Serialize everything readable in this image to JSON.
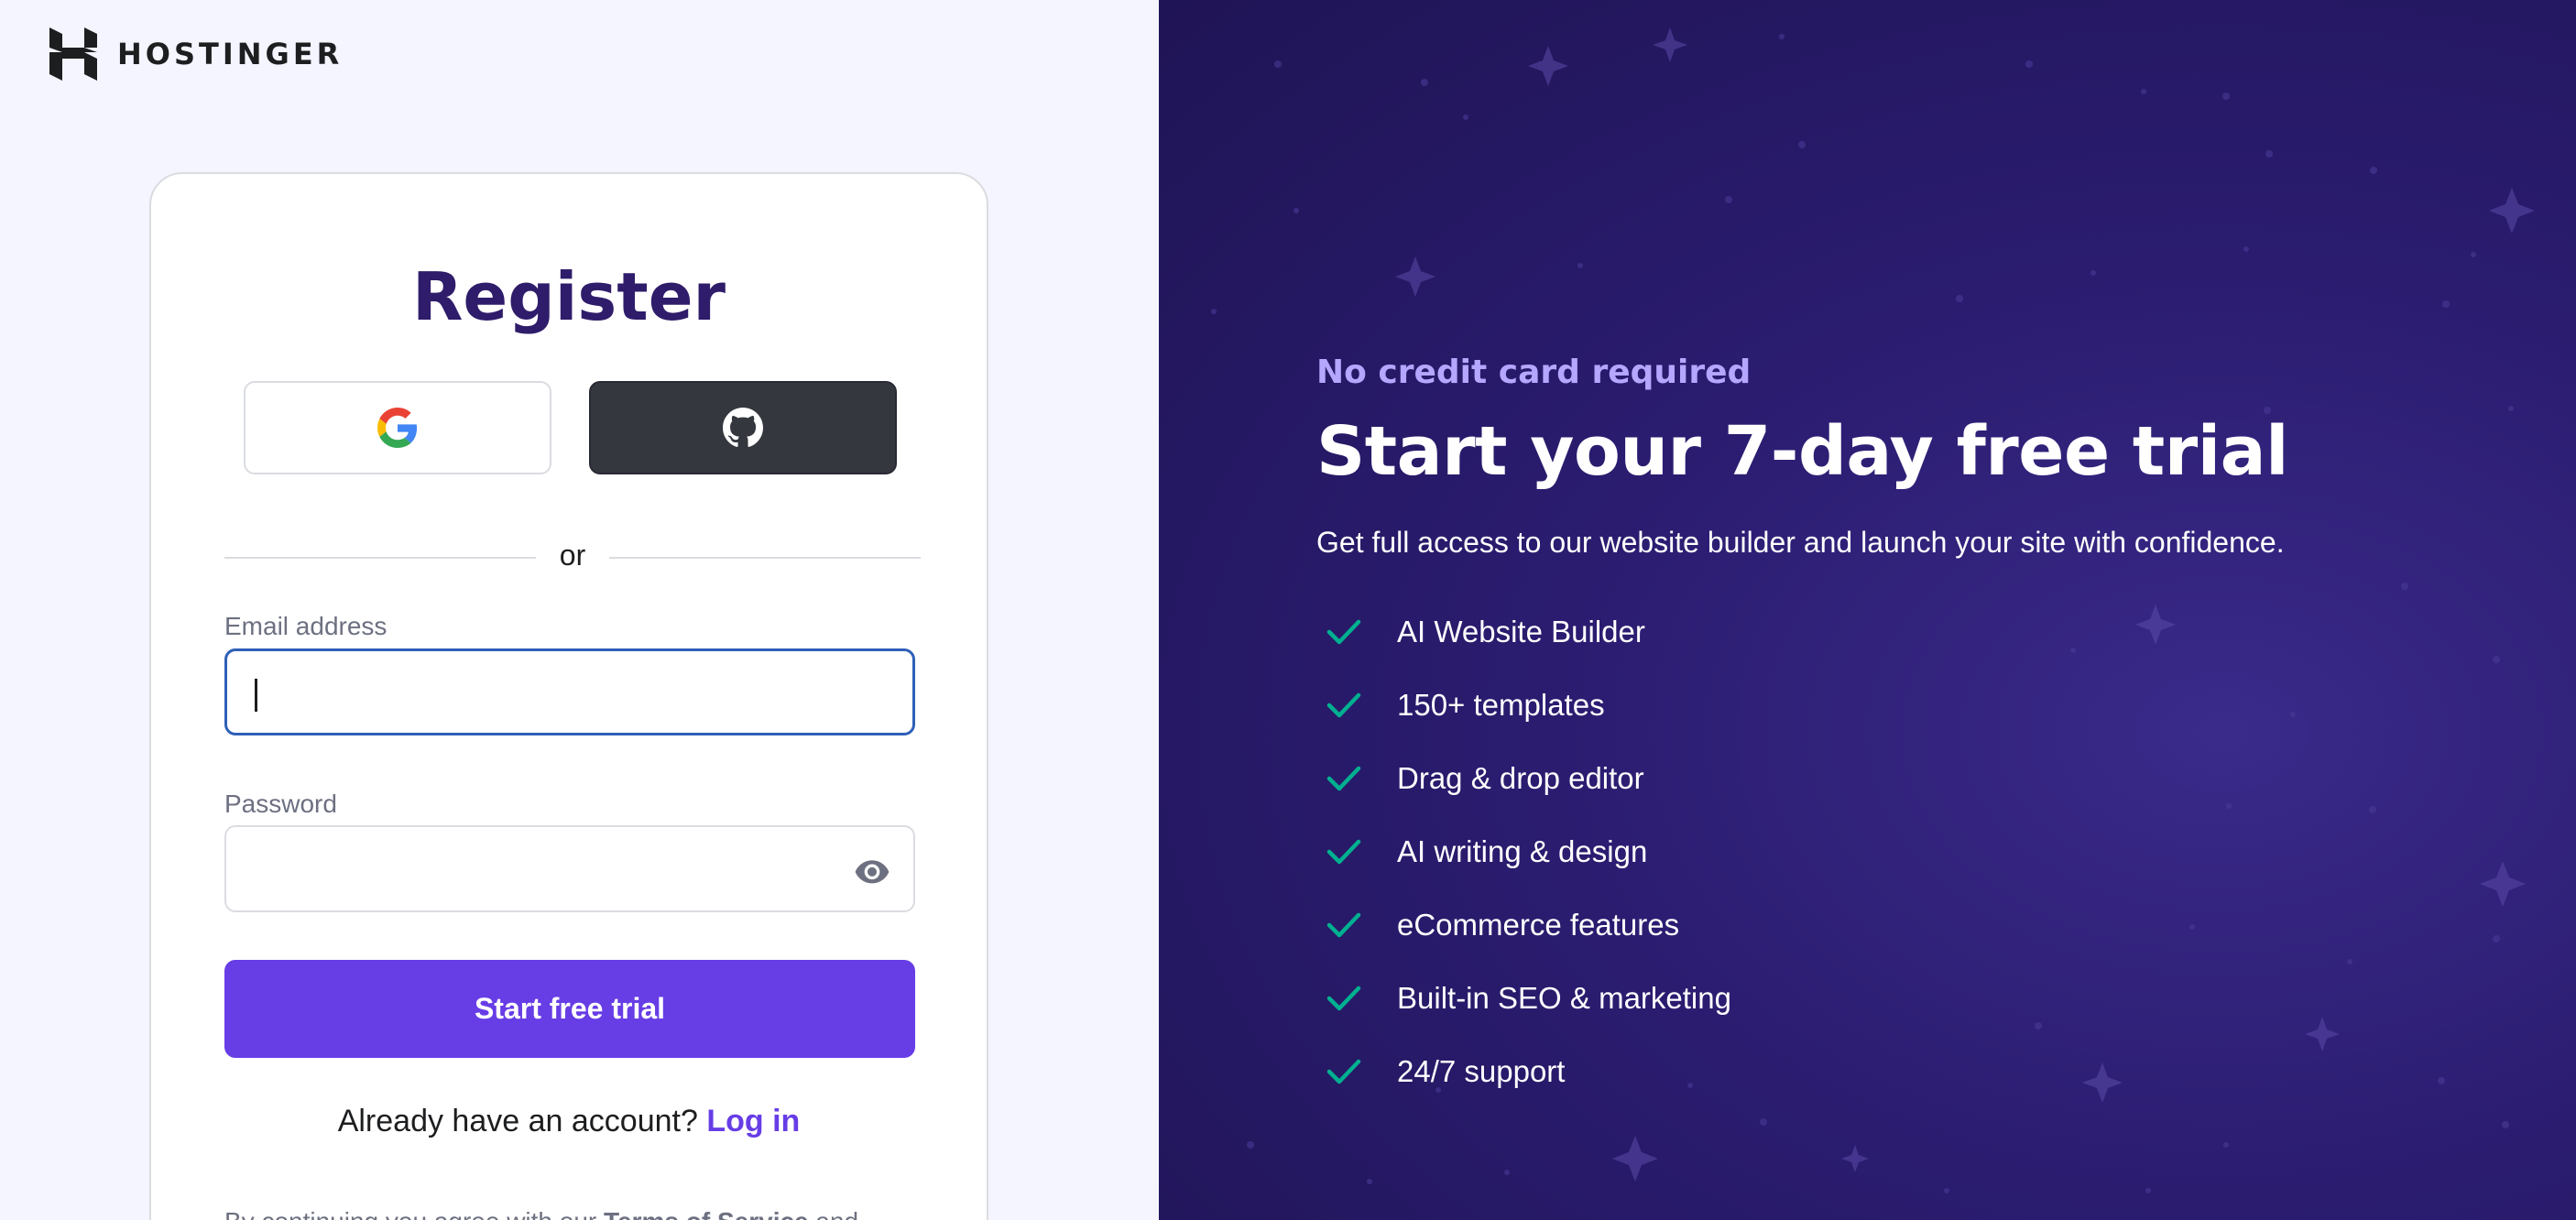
{
  "brand": {
    "name": "HOSTINGER"
  },
  "register": {
    "title": "Register",
    "google_icon": "google-icon",
    "github_icon": "github-icon",
    "divider_text": "or",
    "email_label": "Email address",
    "email_value": "",
    "password_label": "Password",
    "password_value": "",
    "password_toggle_icon": "eye-icon",
    "submit_label": "Start free trial",
    "login_prompt": "Already have an account?",
    "login_link": "Log in",
    "terms_prefix": "By continuing you agree with our",
    "terms_link": "Terms of Service",
    "terms_suffix": "and"
  },
  "promo": {
    "eyebrow": "No credit card required",
    "headline": "Start your 7-day free trial",
    "subtext": "Get full access to our website builder and launch your site with confidence.",
    "features": [
      "AI Website Builder",
      "150+ templates",
      "Drag & drop editor",
      "AI writing & design",
      "eCommerce features",
      "Built-in SEO & marketing",
      "24/7 support"
    ]
  },
  "colors": {
    "brand_purple": "#673de6",
    "dark_panel": "#2b1c70",
    "title_purple": "#2f1c6a",
    "check_green": "#00b090",
    "eyebrow_lilac": "#b5a6ff"
  }
}
